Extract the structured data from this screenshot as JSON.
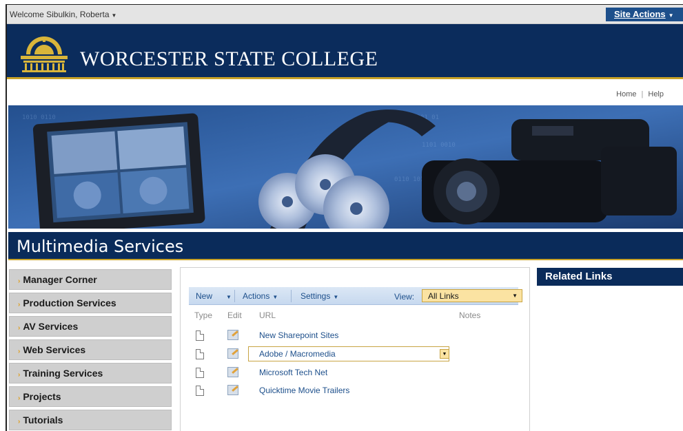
{
  "topbar": {
    "welcome": "Welcome Sibulkin, Roberta",
    "site_actions": "Site Actions"
  },
  "banner": {
    "college_name": "WORCESTER STATE COLLEGE"
  },
  "utilnav": {
    "home": "Home",
    "help": "Help"
  },
  "page": {
    "title": "Multimedia Services"
  },
  "leftnav": {
    "items": [
      {
        "label": "Manager Corner"
      },
      {
        "label": "Production Services"
      },
      {
        "label": "AV Services"
      },
      {
        "label": "Web Services"
      },
      {
        "label": "Training Services"
      },
      {
        "label": "Projects"
      },
      {
        "label": "Tutorials"
      }
    ]
  },
  "list": {
    "toolbar": {
      "new": "New",
      "actions": "Actions",
      "settings": "Settings",
      "view_label": "View:",
      "view_value": "All Links"
    },
    "columns": {
      "type": "Type",
      "edit": "Edit",
      "url": "URL",
      "notes": "Notes"
    },
    "rows": [
      {
        "url": "New Sharepoint Sites"
      },
      {
        "url": "Adobe / Macromedia"
      },
      {
        "url": "Microsoft Tech Net"
      },
      {
        "url": "Quicktime Movie Trailers"
      }
    ]
  },
  "related": {
    "title": "Related Links"
  },
  "colors": {
    "navy": "#0a2b5a",
    "gold": "#c9a227",
    "link": "#1d4f8b",
    "nav_bg": "#cfcfcf"
  }
}
